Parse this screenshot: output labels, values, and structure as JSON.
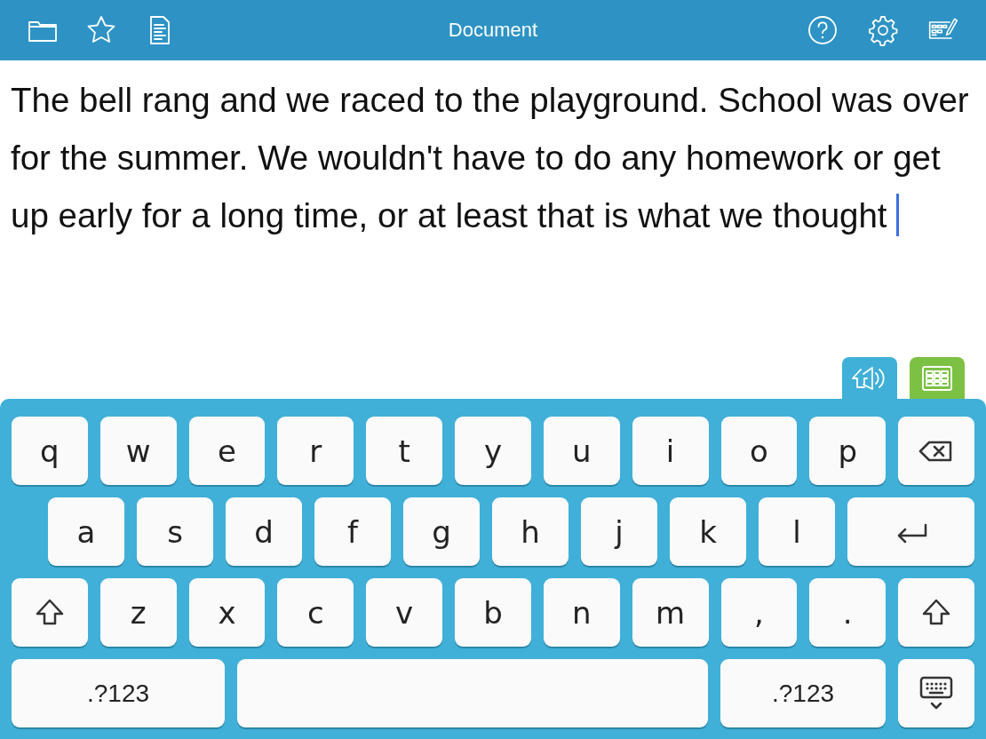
{
  "toolbar": {
    "title": "Document"
  },
  "document": {
    "text": "The bell rang and we raced to the playground. School was over for the summer. We wouldn't have to do any homework or get up early for a long time, or at least that is what we thought "
  },
  "keyboard": {
    "rows": [
      [
        {
          "kind": "char",
          "label": "q"
        },
        {
          "kind": "char",
          "label": "w"
        },
        {
          "kind": "char",
          "label": "e"
        },
        {
          "kind": "char",
          "label": "r"
        },
        {
          "kind": "char",
          "label": "t"
        },
        {
          "kind": "char",
          "label": "y"
        },
        {
          "kind": "char",
          "label": "u"
        },
        {
          "kind": "char",
          "label": "i"
        },
        {
          "kind": "char",
          "label": "o"
        },
        {
          "kind": "char",
          "label": "p"
        },
        {
          "kind": "backspace"
        }
      ],
      [
        {
          "kind": "char",
          "label": "a"
        },
        {
          "kind": "char",
          "label": "s"
        },
        {
          "kind": "char",
          "label": "d"
        },
        {
          "kind": "char",
          "label": "f"
        },
        {
          "kind": "char",
          "label": "g"
        },
        {
          "kind": "char",
          "label": "h"
        },
        {
          "kind": "char",
          "label": "j"
        },
        {
          "kind": "char",
          "label": "k"
        },
        {
          "kind": "char",
          "label": "l"
        },
        {
          "kind": "return"
        }
      ],
      [
        {
          "kind": "shift"
        },
        {
          "kind": "char",
          "label": "z"
        },
        {
          "kind": "char",
          "label": "x"
        },
        {
          "kind": "char",
          "label": "c"
        },
        {
          "kind": "char",
          "label": "v"
        },
        {
          "kind": "char",
          "label": "b"
        },
        {
          "kind": "char",
          "label": "n"
        },
        {
          "kind": "char",
          "label": "m"
        },
        {
          "kind": "char",
          "label": ","
        },
        {
          "kind": "char",
          "label": "."
        },
        {
          "kind": "shift"
        }
      ],
      [
        {
          "kind": "mode",
          "label": ".?123"
        },
        {
          "kind": "space"
        },
        {
          "kind": "mode",
          "label": ".?123"
        },
        {
          "kind": "hide"
        }
      ]
    ]
  }
}
